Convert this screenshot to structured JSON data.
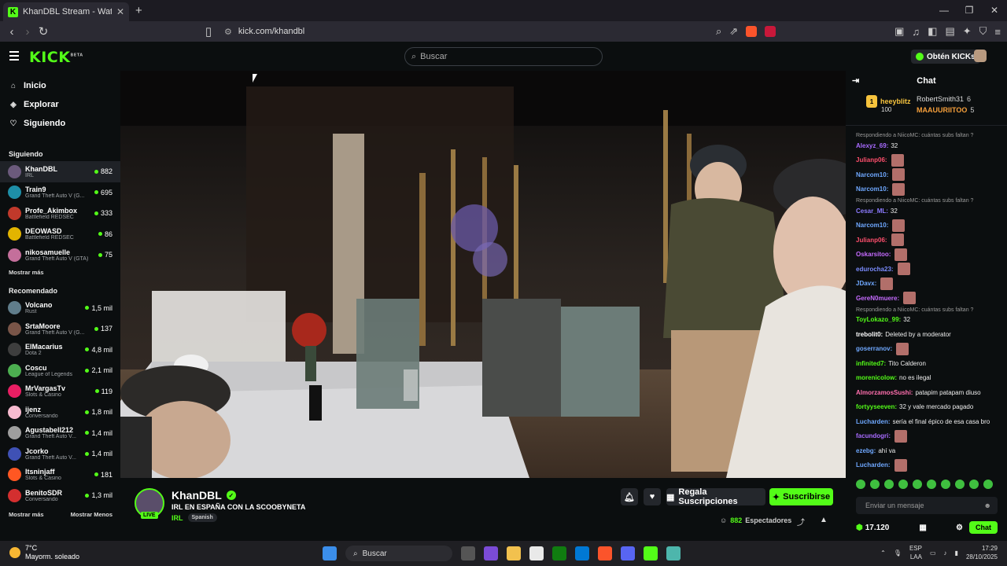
{
  "browser": {
    "tab_title": "KhanDBL Stream - Watch Live on",
    "url": "kick.com/khandbl"
  },
  "header": {
    "search_placeholder": "Buscar",
    "get_kicks": "Obtén KICKs"
  },
  "nav": {
    "items": [
      {
        "label": "Inicio",
        "icon": "home-icon"
      },
      {
        "label": "Explorar",
        "icon": "compass-icon"
      },
      {
        "label": "Siguiendo",
        "icon": "heart-icon"
      }
    ]
  },
  "following": {
    "title": "Siguiendo",
    "channels": [
      {
        "name": "KhanDBL",
        "category": "IRL",
        "viewers": "882",
        "color": "#6b5a7c"
      },
      {
        "name": "Train9",
        "category": "Grand Theft Auto V (G...",
        "viewers": "695",
        "color": "#1e8fa8"
      },
      {
        "name": "Profe_Akimbox",
        "category": "Battlefield REDSEC",
        "viewers": "333",
        "color": "#c0392b"
      },
      {
        "name": "DEOWASD",
        "category": "Battlefield REDSEC",
        "viewers": "86",
        "color": "#e2b400"
      },
      {
        "name": "nikosamuelle",
        "category": "Grand Theft Auto V (GTA)",
        "viewers": "75",
        "color": "#c46f9b"
      }
    ],
    "show_more": "Mostrar más"
  },
  "recommended": {
    "title": "Recomendado",
    "channels": [
      {
        "name": "Volcano",
        "category": "Rust",
        "viewers": "1,5 mil",
        "color": "#607d8b"
      },
      {
        "name": "SrtaMoore",
        "category": "Grand Theft Auto V (G...",
        "viewers": "137",
        "color": "#795548"
      },
      {
        "name": "ElMacarius",
        "category": "Dota 2",
        "viewers": "4,8 mil",
        "color": "#3e3e3e"
      },
      {
        "name": "Coscu",
        "category": "League of Legends",
        "viewers": "2,1 mil",
        "color": "#4caf50"
      },
      {
        "name": "MrVargasTv",
        "category": "Slots & Casino",
        "viewers": "119",
        "color": "#e91e63"
      },
      {
        "name": "ijenz",
        "category": "Conversando",
        "viewers": "1,8 mil",
        "color": "#f8bbd0"
      },
      {
        "name": "Agustabell212",
        "category": "Grand Theft Auto V...",
        "viewers": "1,4 mil",
        "color": "#9e9e9e"
      },
      {
        "name": "Jcorko",
        "category": "Grand Theft Auto V...",
        "viewers": "1,4 mil",
        "color": "#3f51b5"
      },
      {
        "name": "Itsninjaff",
        "category": "Slots & Casino",
        "viewers": "181",
        "color": "#ff5722"
      },
      {
        "name": "BenitoSDR",
        "category": "Conversando",
        "viewers": "1,3 mil",
        "color": "#d32f2f"
      }
    ],
    "show_more": "Mostrar más",
    "show_less": "Mostrar Menos"
  },
  "stream": {
    "streamer": "KhanDBL",
    "live": "LIVE",
    "title": "IRL EN ESPAÑA CON LA SCOOBYNETA",
    "category": "IRL",
    "language": "Spanish",
    "gift_subs": "Regala Suscripciones",
    "subscribe": "Suscribirse",
    "viewers": "882",
    "viewers_label": "Espectadores"
  },
  "chat": {
    "title": "Chat",
    "leaderboard": {
      "first": {
        "rank": "1",
        "name": "heeyblitz",
        "count": "100"
      },
      "second": {
        "name": "RobertSmith31",
        "count": "6"
      },
      "third": {
        "name": "MAAUURIITOO",
        "count": "5"
      }
    },
    "messages": [
      {
        "reply": "Respondiendo a NiicoMC: cuántas subs faltan ?",
        "user": "Alexyz_69:",
        "color": "#a86bff",
        "text": "32",
        "emote": false
      },
      {
        "reply": "",
        "user": "Julianp06:",
        "color": "#ff4f6d",
        "text": "",
        "emote": true
      },
      {
        "reply": "",
        "user": "Narcom10:",
        "color": "#6fa8ff",
        "text": "",
        "emote": true
      },
      {
        "reply": "",
        "user": "Narcom10:",
        "color": "#6fa8ff",
        "text": "",
        "emote": true
      },
      {
        "reply": "Respondiendo a NiicoMC: cuántas subs faltan ?",
        "user": "Cesar_ML:",
        "color": "#8c7bff",
        "text": "32",
        "emote": false
      },
      {
        "reply": "",
        "user": "Narcom10:",
        "color": "#6fa8ff",
        "text": "",
        "emote": true
      },
      {
        "reply": "",
        "user": "Julianp06:",
        "color": "#ff4f6d",
        "text": "",
        "emote": true
      },
      {
        "reply": "",
        "user": "Oskarsitoo:",
        "color": "#c66bff",
        "text": "",
        "emote": true
      },
      {
        "reply": "",
        "user": "edurocha23:",
        "color": "#7b8cff",
        "text": "",
        "emote": true
      },
      {
        "reply": "",
        "user": "JDavx:",
        "color": "#6fa8ff",
        "text": "",
        "emote": true
      },
      {
        "reply": "",
        "user": "GereN0muere:",
        "color": "#c66bff",
        "text": "",
        "emote": true
      },
      {
        "reply": "Respondiendo a NiicoMC: cuántas subs faltan ?",
        "user": "ToyLokazo_99:",
        "color": "#53fc18",
        "text": "32",
        "emote": false
      },
      {
        "reply": "",
        "user": "trebolit0:",
        "color": "#ffffff",
        "text": "Deleted by a moderator",
        "emote": false
      },
      {
        "reply": "",
        "user": "goserranov:",
        "color": "#6fa8ff",
        "text": "",
        "emote": true
      },
      {
        "reply": "",
        "user": "infinited7:",
        "color": "#53fc18",
        "text": "Tito Calderon",
        "emote": false
      },
      {
        "reply": "",
        "user": "morenicolow:",
        "color": "#53fc18",
        "text": "no es ilegal",
        "emote": false
      },
      {
        "reply": "",
        "user": "AlmorzamosSushi:",
        "color": "#ff6fae",
        "text": "patapim patapam diuso",
        "emote": false
      },
      {
        "reply": "",
        "user": "fortyyseeven:",
        "color": "#53fc18",
        "text": "32 y vale mercado pagado",
        "emote": false
      },
      {
        "reply": "",
        "user": "Lucharden:",
        "color": "#6fa8ff",
        "text": "sería el final épico de esa casa bro",
        "emote": false
      },
      {
        "reply": "",
        "user": "facundogri:",
        "color": "#a86bff",
        "text": "",
        "emote": true
      },
      {
        "reply": "",
        "user": "ezebg:",
        "color": "#6fa8ff",
        "text": "ahí va",
        "emote": false
      },
      {
        "reply": "",
        "user": "Lucharden:",
        "color": "#6fa8ff",
        "text": "",
        "emote": true
      }
    ],
    "input_placeholder": "Enviar un mensaje",
    "kicks": "17.120",
    "send": "Chat"
  },
  "taskbar": {
    "temp": "7°C",
    "weather": "Mayorm. soleado",
    "search": "Buscar",
    "lang": "ESP",
    "lang2": "LAA",
    "time": "17:29",
    "date": "28/10/2025"
  },
  "colors": {
    "accent": "#53fc18",
    "bg": "#0b0e0f"
  }
}
